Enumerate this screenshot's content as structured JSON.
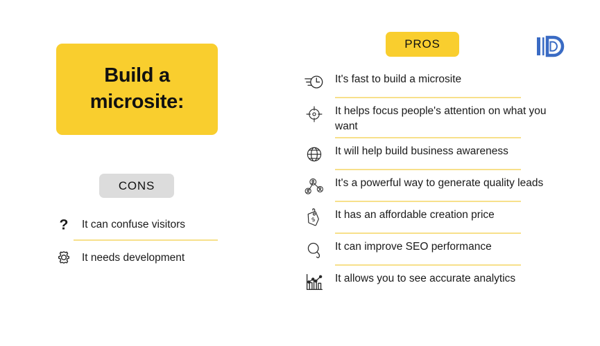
{
  "colors": {
    "accent_yellow": "#F9CE2E",
    "divider_yellow": "#F7E08A",
    "cons_badge_gray": "#DCDCDC",
    "logo_blue": "#3A6BC4",
    "text_dark": "#1a1a1a",
    "background": "#ffffff"
  },
  "logo": {
    "name": "ID",
    "alt": "ID monogram logo"
  },
  "title_card": {
    "text": "Build a\nmicrosite:"
  },
  "cons": {
    "badge_label": "CONS",
    "items": [
      {
        "icon": "question-mark-icon",
        "text": "It can confuse visitors",
        "divider_after": true
      },
      {
        "icon": "gear-icon",
        "text": "It needs development",
        "divider_after": false
      }
    ]
  },
  "pros": {
    "badge_label": "PROS",
    "items": [
      {
        "icon": "fast-clock-icon",
        "text": "It's fast to build a microsite",
        "divider_after": true
      },
      {
        "icon": "target-crosshair-icon",
        "text": "It helps focus people's attention on what you want",
        "divider_after": true
      },
      {
        "icon": "globe-icon",
        "text": "It will help build business awareness",
        "divider_after": true
      },
      {
        "icon": "people-network-icon",
        "text": "It's a powerful way to generate quality leads",
        "divider_after": true
      },
      {
        "icon": "price-tag-icon",
        "text": "It has an affordable creation price",
        "divider_after": true
      },
      {
        "icon": "magnifier-icon",
        "text": "It can improve SEO performance",
        "divider_after": true
      },
      {
        "icon": "bar-chart-icon",
        "text": "It allows you to see accurate analytics",
        "divider_after": false
      }
    ]
  }
}
